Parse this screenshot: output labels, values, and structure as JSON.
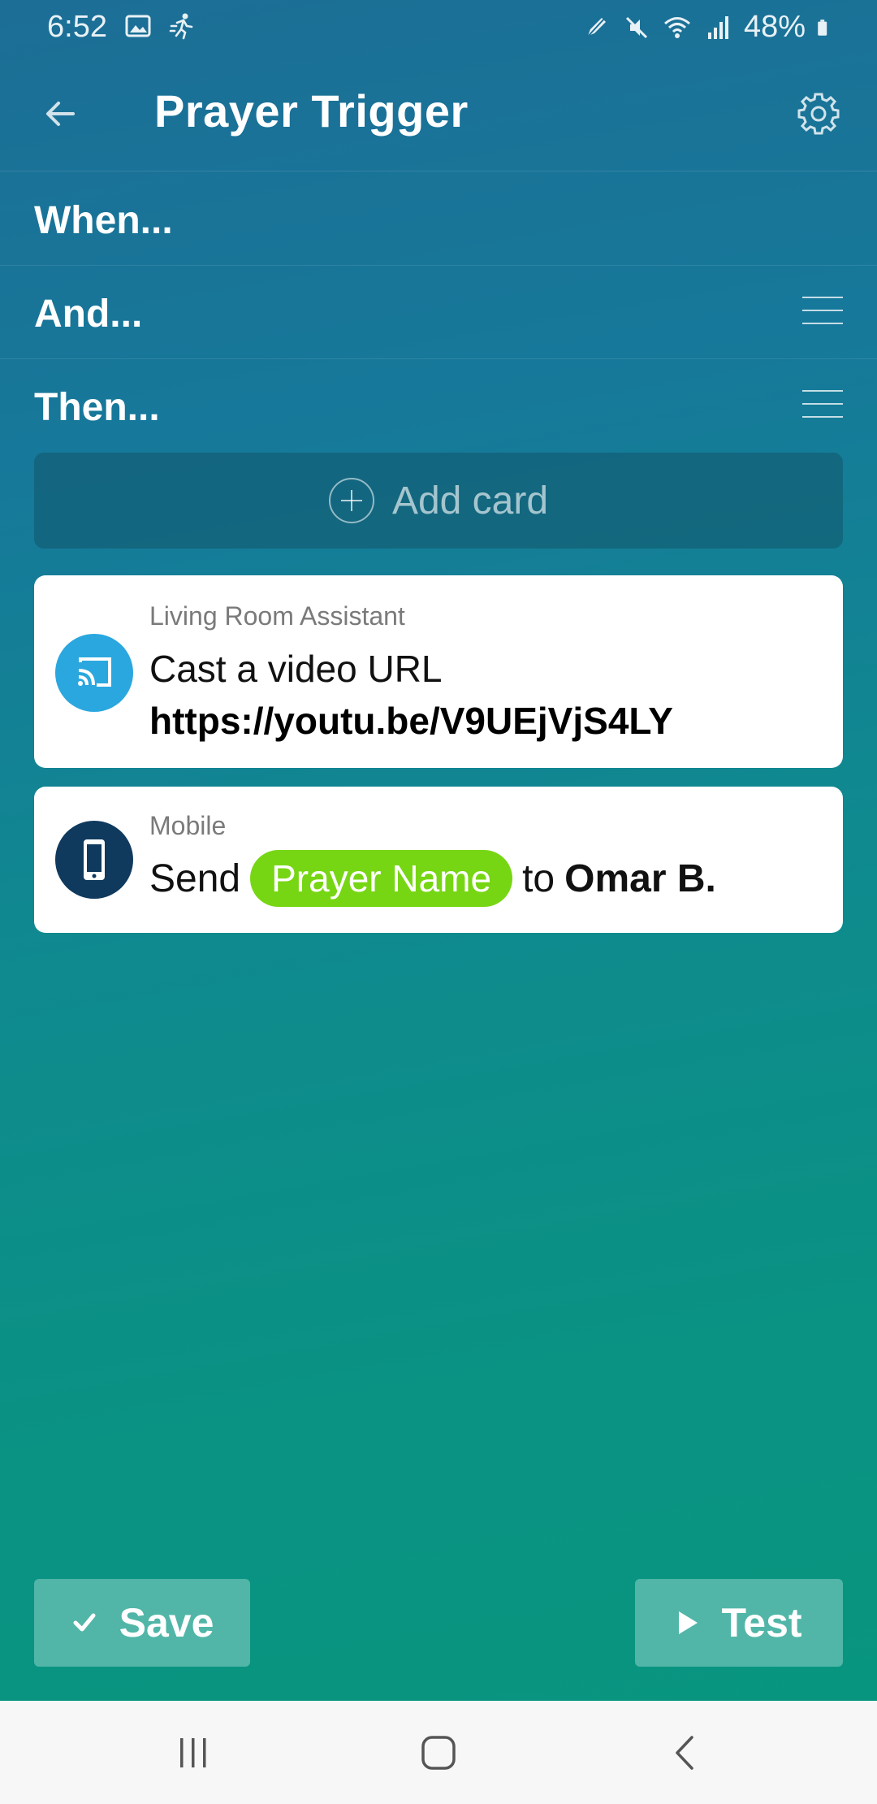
{
  "status_bar": {
    "time": "6:52",
    "battery_text": "48%",
    "left_icons": [
      "image-icon",
      "running-icon"
    ],
    "right_icons": [
      "pen-icon",
      "mute-icon",
      "wifi-icon",
      "signal-icon",
      "battery-icon"
    ]
  },
  "app_bar": {
    "title": "Prayer Trigger",
    "back_icon": "back-arrow-icon",
    "settings_icon": "gear-icon"
  },
  "sections": {
    "when_label": "When...",
    "and_label": "And...",
    "then_label": "Then..."
  },
  "add_card": {
    "label": "Add card",
    "icon": "plus-circle-icon"
  },
  "cards": [
    {
      "device": "Living Room Assistant",
      "action": "Cast a video URL",
      "value": "https://youtu.be/V9UEjVjS4LY",
      "icon": "cast-icon",
      "icon_color": "#2ba7df"
    },
    {
      "device": "Mobile",
      "action_prefix": "Send",
      "pill": "Prayer Name",
      "pill_color": "#77d613",
      "connector": "to",
      "recipient": "Omar B.",
      "icon": "phone-icon",
      "icon_color": "#0f3a5e"
    }
  ],
  "actions": {
    "save_label": "Save",
    "test_label": "Test"
  },
  "nav_bar": {
    "icons": [
      "recent-apps-icon",
      "home-icon",
      "back-icon"
    ]
  }
}
